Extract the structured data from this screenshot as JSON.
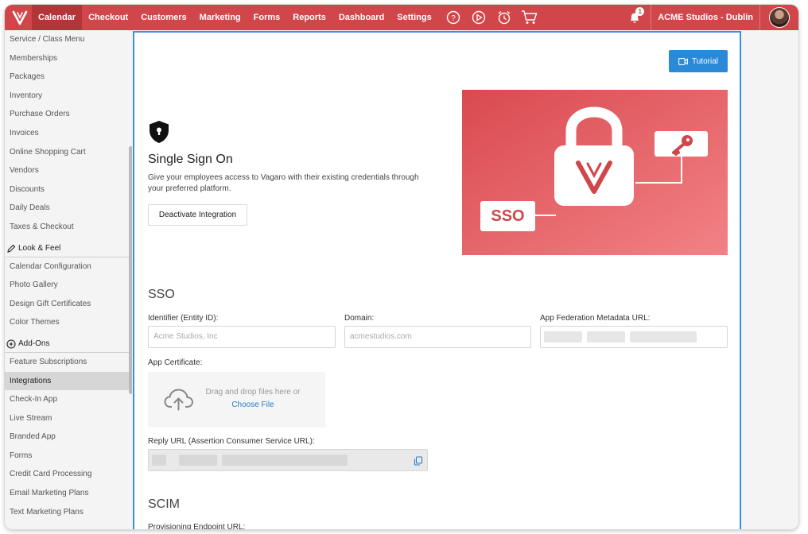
{
  "nav": {
    "items": [
      "Calendar",
      "Checkout",
      "Customers",
      "Marketing",
      "Forms",
      "Reports",
      "Dashboard",
      "Settings"
    ],
    "active": "Calendar",
    "icons": [
      "help-circle-icon",
      "play-circle-icon",
      "alarm-clock-icon",
      "shopping-cart-icon"
    ],
    "notification_count": "1",
    "studio": "ACME Studios - Dublin",
    "brand_color": "#d0464a"
  },
  "sidebar": {
    "group1": [
      "Service / Class Menu",
      "Memberships",
      "Packages",
      "Inventory",
      "Purchase Orders",
      "Invoices",
      "Online Shopping Cart",
      "Vendors",
      "Discounts",
      "Daily Deals",
      "Taxes & Checkout"
    ],
    "look_feel": {
      "heading": "Look & Feel",
      "items": [
        "Calendar Configuration",
        "Photo Gallery",
        "Design Gift Certificates",
        "Color Themes"
      ]
    },
    "addons": {
      "heading": "Add-Ons",
      "items": [
        "Feature Subscriptions",
        "Integrations",
        "Check-In App",
        "Live Stream",
        "Branded App",
        "Forms",
        "Credit Card Processing",
        "Email Marketing Plans",
        "Text Marketing Plans"
      ]
    },
    "active": "Integrations"
  },
  "main": {
    "tutorial_label": "Tutorial",
    "title": "Single Sign On",
    "description": "Give your employees access to Vagaro with their existing credentials through your preferred platform.",
    "deactivate_label": "Deactivate Integration",
    "hero_sso_label": "SSO",
    "sso_section": {
      "title": "SSO",
      "identifier": {
        "label": "Identifier (Entity ID):",
        "placeholder": "Acme Studios, Inc"
      },
      "domain": {
        "label": "Domain:",
        "placeholder": "acmestudios.com"
      },
      "metadata_url": {
        "label": "App Federation Metadata URL:"
      },
      "certificate": {
        "label": "App Certificate:",
        "drop_text": "Drag and drop files here or",
        "choose_file": "Choose File"
      },
      "reply_url": {
        "label": "Reply URL (Assertion Consumer Service URL):"
      }
    },
    "scim_section": {
      "title": "SCIM",
      "endpoint_label": "Provisioning Endpoint URL:"
    }
  }
}
